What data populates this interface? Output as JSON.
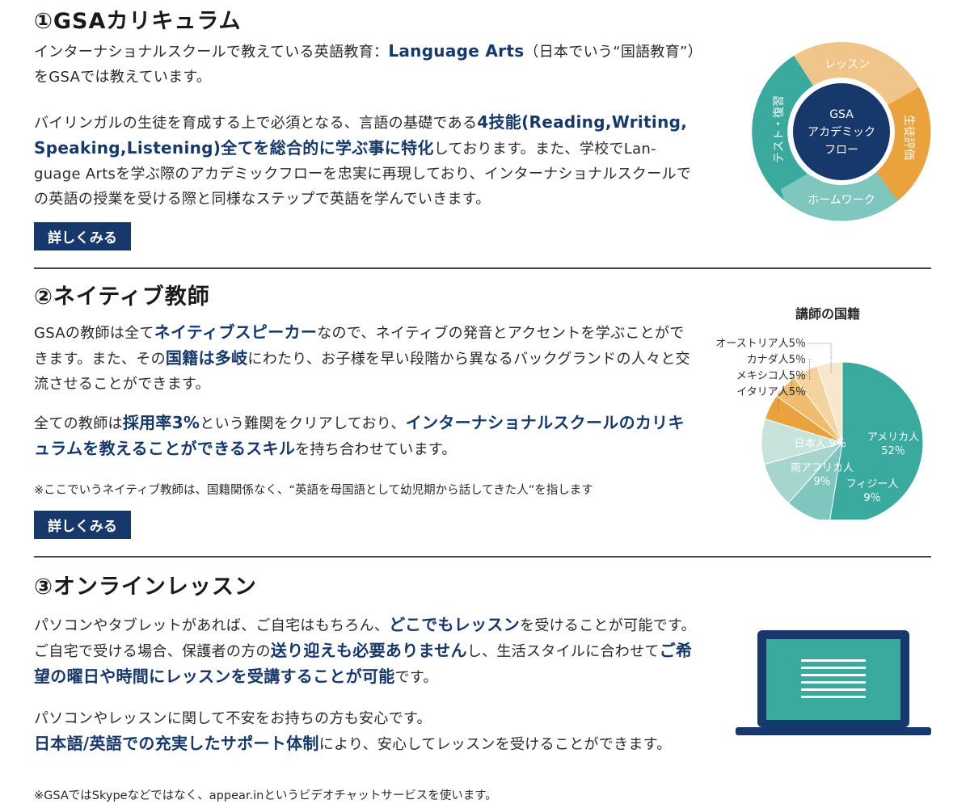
{
  "section1": {
    "title": "①GSAカリキュラム",
    "intro": [
      "インターナショナルスクールで教えている英語教育：",
      "Language Arts",
      "（日本でいう“国語教育”）をGSAでは教えています。"
    ],
    "body": [
      "バイリンガルの生徒を育成する上で必須となる、言語の基礎である",
      "4技能(Reading,Writing, Speaking,Listening)全てを総合的に学ぶ事に特化",
      "しております。また、学校でLan-guage Artsを学ぶ際のアカデミックフローを忠実に再現しており、インターナショナルスクールでの英語の授業を受ける際と同様なステップで英語を学んでいきます。"
    ],
    "button": "詳しくみる",
    "cycle": {
      "center": [
        "GSA",
        "アカデミック",
        "フロー"
      ],
      "segments": [
        "レッスン",
        "生徒評価",
        "ホームワーク",
        "テスト・復習"
      ]
    }
  },
  "section2": {
    "title": "②ネイティブ教師",
    "p1": [
      "GSAの教師は全て",
      "ネイティブスピーカー",
      "なので、ネイティブの発音とアクセントを学ぶことができます。また、その",
      "国籍は多岐",
      "にわたり、お子様を早い段階から異なるバックグランドの人々と交流させることができます。"
    ],
    "p2": [
      "全ての教師は",
      "採用率3%",
      "という難関をクリアしており、",
      "インターナショナルスクールのカリキュラムを教えることができるスキル",
      "を持ち合わせています。"
    ],
    "note": "※ここでいうネイティブ教師は、国籍関係なく、“英語を母国語として幼児期から話してきた人”を指します",
    "button": "詳しくみる"
  },
  "section3": {
    "title": "③オンラインレッスン",
    "p1": [
      "パソコンやタブレットがあれば、ご自宅はもちろん、",
      "どこでもレッスン",
      "を受けることが可能です。ご自宅で受ける場合、保護者の方の",
      "送り迎えも必要ありません",
      "し、生活スタイルに合わせて",
      "ご希望の曜日や時間にレッスンを受講することが可能",
      "です。"
    ],
    "p2": [
      "パソコンやレッスンに関して不安をお持ちの方も安心です。",
      "日本語/英語での充実したサポート体制",
      "により、安心してレッスンを受けることができます。"
    ],
    "note": "※GSAではSkypeなどではなく、appear.inというビデオチャットサービスを使います。"
  },
  "chart_data": {
    "type": "pie",
    "title": "講師の国籍",
    "categories": [
      "アメリカ人",
      "フィジー人",
      "南アフリカ人",
      "日本人",
      "イタリア人",
      "メキシコ人",
      "カナダ人",
      "オーストリア人"
    ],
    "values": [
      52,
      9,
      9,
      9,
      5,
      5,
      5,
      5
    ],
    "labels": [
      "アメリカ人 52％",
      "フィジー人 9％",
      "南アフリカ人 9％",
      "日本人 9％",
      "イタリア人5％",
      "メキシコ人5％",
      "カナダ人5％",
      "オーストリア人5％"
    ],
    "colors": [
      "#3aaa9e",
      "#7fc7be",
      "#a6d5cd",
      "#c7e3dc",
      "#e9a23c",
      "#efbb6c",
      "#f5d3a0",
      "#f8e7cc"
    ]
  },
  "colors": {
    "accent": "#16386b",
    "teal": "#3aaa9e",
    "orange": "#e9a23c"
  }
}
